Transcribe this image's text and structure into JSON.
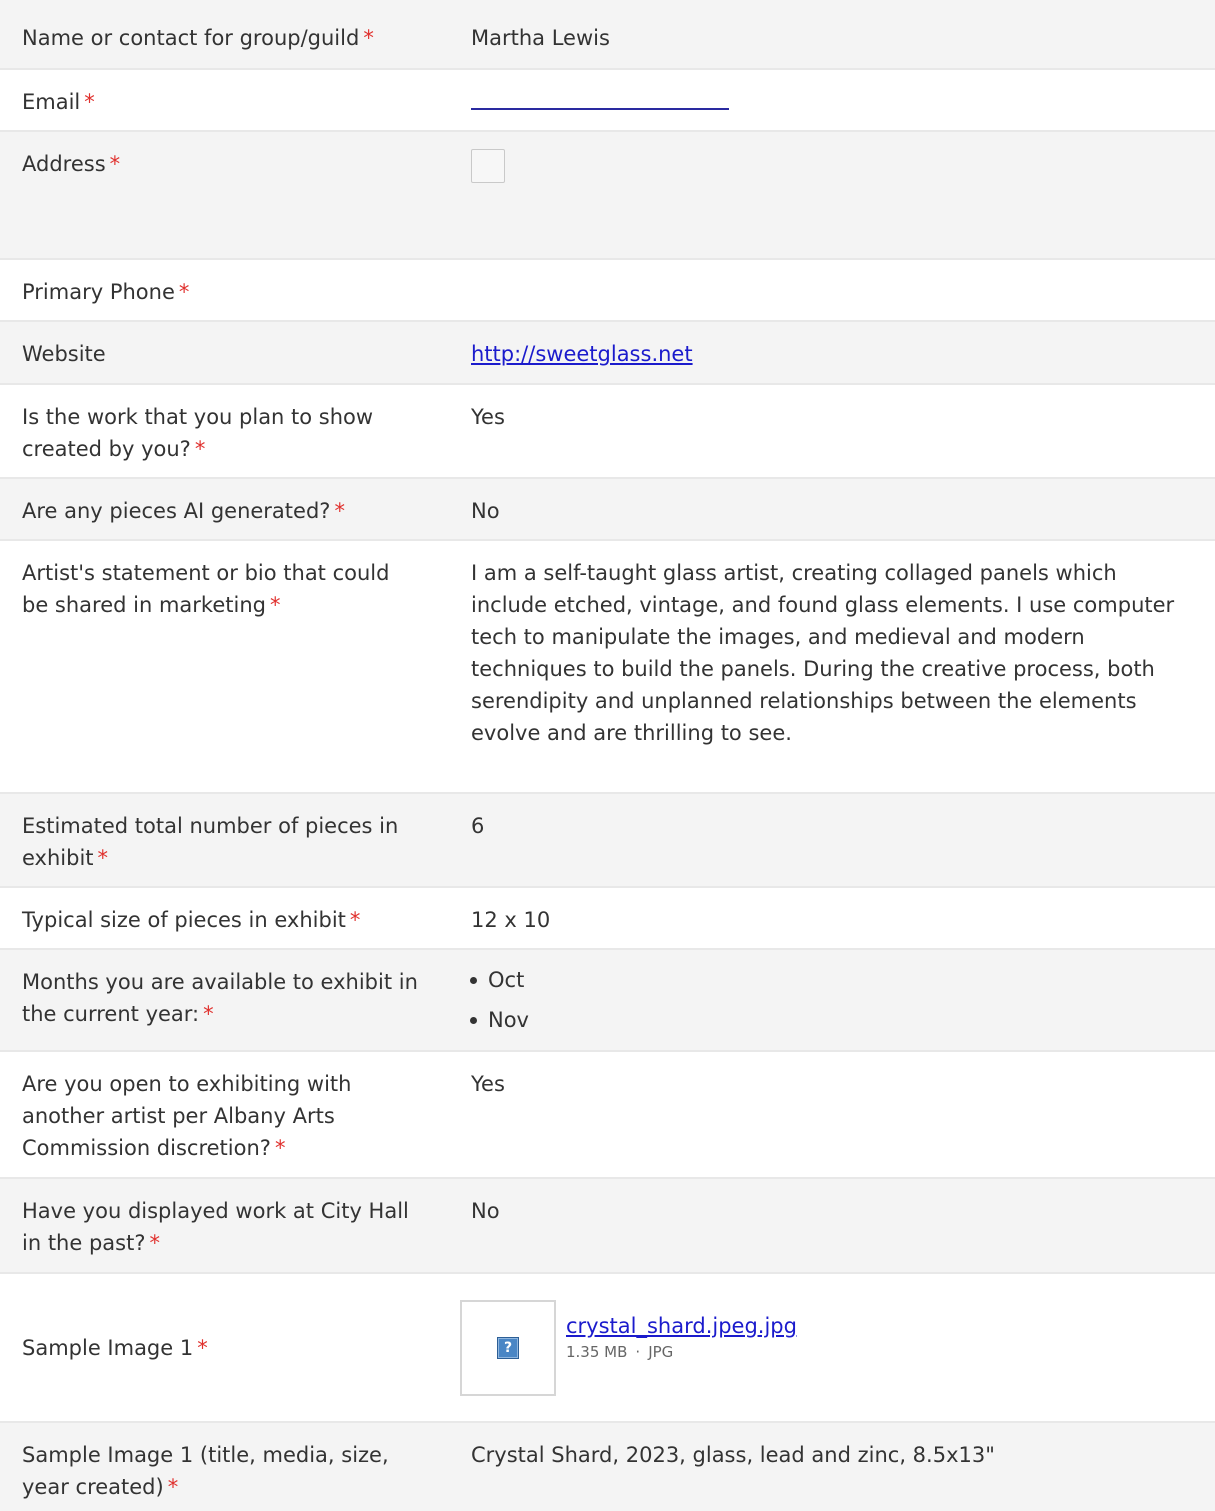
{
  "required_mark": "*",
  "fields": {
    "name": {
      "label": "Name or contact for group/guild",
      "value": "Martha  Lewis"
    },
    "email": {
      "label": "Email",
      "value": ""
    },
    "address": {
      "label": "Address"
    },
    "phone": {
      "label": "Primary Phone",
      "value": ""
    },
    "website": {
      "label": "Website",
      "value": "http://sweetglass.net"
    },
    "created_by_you": {
      "label": "Is the work that you plan to show created by you?",
      "value": "Yes"
    },
    "ai_generated": {
      "label": "Are any pieces AI generated?",
      "value": "No"
    },
    "statement": {
      "label": "Artist's statement or bio that could be shared in marketing",
      "value": "I am a self-taught glass artist, creating collaged panels which include etched, vintage, and found glass elements. I use computer tech to manipulate the images, and medieval and modern techniques to build the panels. During the creative process, both serendipity and unplanned relationships between the elements evolve and are thrilling to see."
    },
    "num_pieces": {
      "label": "Estimated total number of pieces in exhibit",
      "value": "6"
    },
    "typical_size": {
      "label": "Typical size of pieces in exhibit",
      "value": "12 x 10"
    },
    "months": {
      "label": "Months you are available to exhibit in the current year:",
      "values": [
        "Oct",
        "Nov"
      ]
    },
    "open_to_sharing": {
      "label": "Are you open to exhibiting with another artist per Albany Arts Commission discretion?",
      "value": "Yes"
    },
    "displayed_before": {
      "label": "Have you displayed work at City Hall in the past?",
      "value": "No"
    },
    "sample_image_1": {
      "label": "Sample Image 1",
      "file_name": "crystal_shard.jpeg.jpg",
      "file_size": "1.35 MB",
      "separator": "·",
      "file_type": "JPG",
      "thumb_icon": "broken-image-question-icon"
    },
    "sample_image_1_desc": {
      "label": "Sample Image 1 (title, media, size, year created)",
      "value": "Crystal Shard, 2023, glass, lead and zinc, 8.5x13\""
    }
  }
}
